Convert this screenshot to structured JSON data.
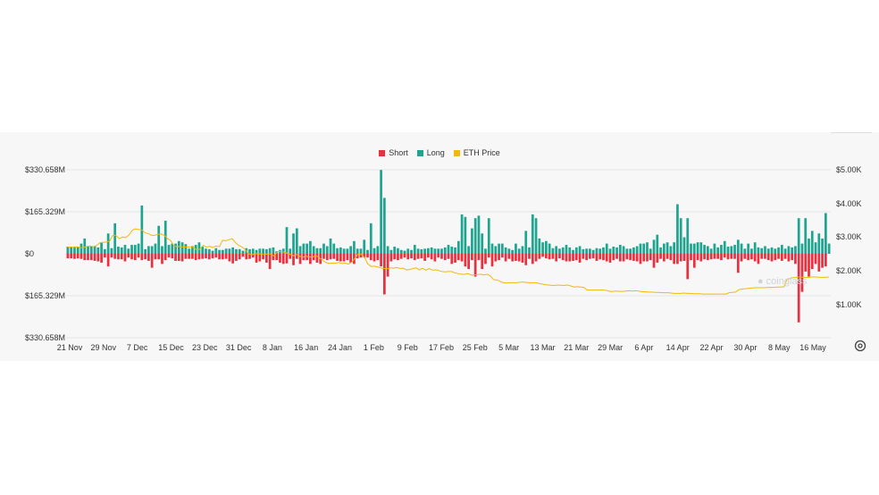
{
  "legend": {
    "short_label": "Short",
    "long_label": "Long",
    "price_label": "ETH Price"
  },
  "watermark": "coinglass",
  "colors": {
    "short": "#e8303e",
    "long": "#1fa58f",
    "price": "#f0b90b",
    "grid": "#e6e6e6",
    "text": "#333333"
  },
  "chart_data": {
    "type": "bar",
    "title": "",
    "xlabel": "",
    "ylabel": "",
    "y_left_ticks": [
      "$330.658M",
      "$165.329M",
      "$0",
      "$165.329M",
      "$330.658M"
    ],
    "y_left_range": [
      -330.658,
      330.658
    ],
    "y_right_ticks": [
      "$5.00K",
      "$4.00K",
      "$3.00K",
      "$2.00K",
      "$1.00K"
    ],
    "y_right_range": [
      0,
      5000
    ],
    "x_ticks": [
      "21 Nov",
      "29 Nov",
      "7 Dec",
      "15 Dec",
      "23 Dec",
      "31 Dec",
      "8 Jan",
      "16 Jan",
      "24 Jan",
      "1 Feb",
      "9 Feb",
      "17 Feb",
      "25 Feb",
      "5 Mar",
      "13 Mar",
      "21 Mar",
      "29 Mar",
      "6 Apr",
      "14 Apr",
      "22 Apr",
      "30 Apr",
      "8 May",
      "16 May"
    ],
    "grid": true,
    "legend_position": "top",
    "series": [
      {
        "name": "Long",
        "unit": "M USD",
        "values": [
          28,
          28,
          28,
          28,
          40,
          60,
          30,
          30,
          30,
          25,
          45,
          18,
          80,
          22,
          120,
          28,
          25,
          35,
          20,
          35,
          35,
          40,
          190,
          18,
          30,
          30,
          40,
          110,
          30,
          130,
          35,
          40,
          40,
          50,
          45,
          38,
          20,
          30,
          35,
          45,
          28,
          20,
          18,
          12,
          22,
          15,
          15,
          20,
          20,
          25,
          18,
          18,
          12,
          22,
          18,
          20,
          15,
          20,
          20,
          18,
          22,
          25,
          10,
          15,
          20,
          105,
          20,
          80,
          100,
          30,
          40,
          40,
          50,
          30,
          22,
          22,
          40,
          30,
          60,
          40,
          22,
          25,
          20,
          20,
          30,
          50,
          20,
          20,
          55,
          15,
          120,
          22,
          30,
          330,
          220,
          30,
          15,
          28,
          22,
          15,
          12,
          20,
          15,
          35,
          20,
          18,
          20,
          22,
          25,
          20,
          20,
          20,
          25,
          35,
          28,
          25,
          50,
          155,
          145,
          30,
          100,
          140,
          150,
          80,
          20,
          140,
          40,
          30,
          40,
          40,
          25,
          20,
          15,
          40,
          20,
          30,
          90,
          25,
          155,
          140,
          60,
          45,
          50,
          40,
          22,
          30,
          20,
          25,
          35,
          25,
          15,
          25,
          30,
          18,
          20,
          20,
          15,
          22,
          20,
          25,
          40,
          20,
          28,
          25,
          35,
          30,
          20,
          20,
          25,
          30,
          40,
          40,
          45,
          20,
          55,
          75,
          25,
          40,
          45,
          30,
          45,
          195,
          140,
          65,
          140,
          40,
          40,
          45,
          45,
          35,
          30,
          20,
          40,
          25,
          35,
          50,
          28,
          30,
          35,
          55,
          40,
          20,
          40,
          20,
          45,
          25,
          22,
          30,
          20,
          25,
          20,
          25,
          35,
          20,
          30,
          25,
          30,
          140,
          40,
          140,
          60,
          90,
          45,
          80,
          60,
          160,
          40
        ]
      },
      {
        "name": "Short",
        "unit": "M USD",
        "values": [
          18,
          18,
          20,
          18,
          20,
          25,
          25,
          25,
          28,
          30,
          35,
          15,
          50,
          15,
          20,
          22,
          22,
          30,
          15,
          22,
          25,
          15,
          25,
          22,
          28,
          55,
          22,
          22,
          40,
          25,
          15,
          18,
          28,
          28,
          30,
          20,
          20,
          20,
          25,
          22,
          20,
          18,
          22,
          18,
          15,
          22,
          22,
          20,
          30,
          38,
          28,
          22,
          12,
          22,
          20,
          15,
          35,
          30,
          22,
          35,
          60,
          25,
          25,
          35,
          40,
          38,
          20,
          45,
          20,
          40,
          25,
          25,
          40,
          25,
          35,
          40,
          20,
          25,
          22,
          20,
          28,
          30,
          30,
          25,
          35,
          40,
          18,
          15,
          15,
          15,
          25,
          30,
          25,
          50,
          160,
          90,
          30,
          22,
          25,
          20,
          15,
          22,
          18,
          25,
          20,
          18,
          28,
          15,
          22,
          30,
          15,
          20,
          25,
          20,
          40,
          35,
          25,
          30,
          50,
          60,
          25,
          90,
          25,
          60,
          40,
          15,
          50,
          30,
          25,
          15,
          30,
          20,
          30,
          28,
          30,
          35,
          45,
          20,
          40,
          30,
          20,
          12,
          18,
          22,
          20,
          30,
          18,
          25,
          30,
          30,
          28,
          25,
          35,
          20,
          25,
          20,
          18,
          28,
          22,
          25,
          30,
          35,
          25,
          20,
          30,
          30,
          22,
          25,
          28,
          30,
          40,
          30,
          30,
          25,
          55,
          35,
          20,
          30,
          20,
          25,
          40,
          40,
          30,
          28,
          100,
          25,
          55,
          25,
          30,
          22,
          25,
          22,
          20,
          20,
          25,
          15,
          22,
          20,
          20,
          75,
          30,
          20,
          25,
          22,
          30,
          40,
          20,
          20,
          25,
          30,
          25,
          20,
          28,
          20,
          30,
          25,
          40,
          270,
          150,
          70,
          90,
          60,
          40,
          70,
          55,
          50
        ]
      },
      {
        "name": "ETH Price",
        "unit": "USD",
        "values": [
          2700,
          2700,
          2690,
          2705,
          2680,
          2690,
          2720,
          2730,
          2710,
          2750,
          2830,
          2840,
          2850,
          2880,
          3050,
          3040,
          2950,
          3000,
          2980,
          3060,
          3200,
          3240,
          3220,
          3210,
          3120,
          3100,
          3050,
          3050,
          3080,
          3090,
          3040,
          2950,
          2880,
          2720,
          2720,
          2710,
          2700,
          2700,
          2700,
          2690,
          2610,
          2640,
          2750,
          2700,
          2720,
          2690,
          2730,
          2710,
          2900,
          2890,
          2920,
          2950,
          2830,
          2750,
          2700,
          2630,
          2500,
          2470,
          2500,
          2500,
          2490,
          2470,
          2500,
          2490,
          2430,
          2560,
          2570,
          2550,
          2520,
          2480,
          2440,
          2480,
          2420,
          2400,
          2430,
          2400,
          2410,
          2440,
          2380,
          2310,
          2240,
          2210,
          2220,
          2220,
          2240,
          2210,
          2220,
          2190,
          2250,
          2360,
          2490,
          2480,
          2390,
          2200,
          2120,
          2130,
          2110,
          2080,
          2060,
          2050,
          2080,
          2070,
          2090,
          2060,
          2070,
          2020,
          2030,
          2060,
          2080,
          2020,
          2070,
          2010,
          2060,
          2010,
          2020,
          2000,
          1970,
          1960,
          1970,
          1970,
          1930,
          1910,
          1890,
          1890,
          1910,
          1870,
          1870,
          1880,
          1890,
          1870,
          1890,
          1840,
          1730,
          1720,
          1680,
          1640,
          1630,
          1640,
          1640,
          1640,
          1650,
          1660,
          1650,
          1640,
          1640,
          1640,
          1620,
          1600,
          1580,
          1570,
          1560,
          1560,
          1570,
          1560,
          1560,
          1570,
          1540,
          1510,
          1520,
          1510,
          1500,
          1420,
          1420,
          1420,
          1420,
          1420,
          1420,
          1410,
          1380,
          1380,
          1390,
          1380,
          1380,
          1390,
          1400,
          1390,
          1400,
          1390,
          1370,
          1370,
          1360,
          1360,
          1350,
          1350,
          1340,
          1340,
          1340,
          1330,
          1320,
          1320,
          1320,
          1330,
          1320,
          1320,
          1310,
          1310,
          1310,
          1300,
          1300,
          1300,
          1300,
          1300,
          1300,
          1300,
          1300,
          1340,
          1350,
          1360,
          1430,
          1450,
          1460,
          1470,
          1480,
          1490,
          1490,
          1490,
          1490,
          1500,
          1500,
          1500,
          1510,
          1510,
          1520,
          1750,
          1760,
          1800,
          1800,
          1810,
          1800,
          1800,
          1800,
          1810,
          1810,
          1800,
          1800,
          1800,
          1810
        ]
      }
    ]
  }
}
